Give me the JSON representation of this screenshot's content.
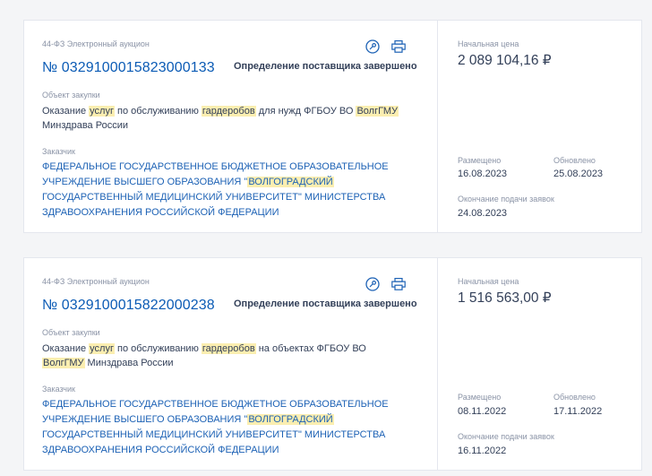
{
  "colors": {
    "link": "#1d62b5",
    "highlight": "#fbeeb0",
    "muted": "#8a93a6",
    "text": "#334059"
  },
  "icons": {
    "key": "key-icon",
    "print": "printer-icon"
  },
  "cards": [
    {
      "type": "44-ФЗ Электронный аукцион",
      "number": "№ 0329100015823000133",
      "status": "Определение поставщика завершено",
      "object_label": "Объект закупки",
      "object_parts": [
        {
          "t": "Оказание ",
          "h": false
        },
        {
          "t": "услуг",
          "h": true
        },
        {
          "t": " по обслуживанию ",
          "h": false
        },
        {
          "t": "гардеробов",
          "h": true
        },
        {
          "t": " для нужд ФГБОУ ВО ",
          "h": false
        },
        {
          "t": "ВолгГМУ",
          "h": true
        },
        {
          "t": " Минздрава России",
          "h": false
        }
      ],
      "customer_label": "Заказчик",
      "customer_parts": [
        {
          "t": "ФЕДЕРАЛЬНОЕ ГОСУДАРСТВЕННОЕ БЮДЖЕТНОЕ ОБРАЗОВАТЕЛЬНОЕ УЧРЕЖДЕНИЕ ВЫСШЕГО ОБРАЗОВАНИЯ \"",
          "h": false
        },
        {
          "t": "ВОЛГОГРАДСКИЙ",
          "h": true
        },
        {
          "t": " ГОСУДАРСТВЕННЫЙ МЕДИЦИНСКИЙ УНИВЕРСИТЕТ\" МИНИСТЕРСТВА ЗДРАВООХРАНЕНИЯ РОССИЙСКОЙ ФЕДЕРАЦИИ",
          "h": false
        }
      ],
      "price_label": "Начальная цена",
      "price": "2 089 104,16 ₽",
      "posted_label": "Размещено",
      "posted": "16.08.2023",
      "updated_label": "Обновлено",
      "updated": "25.08.2023",
      "deadline_label": "Окончание подачи заявок",
      "deadline": "24.08.2023"
    },
    {
      "type": "44-ФЗ Электронный аукцион",
      "number": "№ 0329100015822000238",
      "status": "Определение поставщика завершено",
      "object_label": "Объект закупки",
      "object_parts": [
        {
          "t": "Оказание ",
          "h": false
        },
        {
          "t": "услуг",
          "h": true
        },
        {
          "t": " по обслуживанию ",
          "h": false
        },
        {
          "t": "гардеробов",
          "h": true
        },
        {
          "t": " на объектах ФГБОУ ВО ",
          "h": false
        },
        {
          "t": "ВолгГМУ",
          "h": true
        },
        {
          "t": " Минздрава России",
          "h": false
        }
      ],
      "customer_label": "Заказчик",
      "customer_parts": [
        {
          "t": "ФЕДЕРАЛЬНОЕ ГОСУДАРСТВЕННОЕ БЮДЖЕТНОЕ ОБРАЗОВАТЕЛЬНОЕ УЧРЕЖДЕНИЕ ВЫСШЕГО ОБРАЗОВАНИЯ \"",
          "h": false
        },
        {
          "t": "ВОЛГОГРАДСКИЙ",
          "h": true
        },
        {
          "t": " ГОСУДАРСТВЕННЫЙ МЕДИЦИНСКИЙ УНИВЕРСИТЕТ\" МИНИСТЕРСТВА ЗДРАВООХРАНЕНИЯ РОССИЙСКОЙ ФЕДЕРАЦИИ",
          "h": false
        }
      ],
      "price_label": "Начальная цена",
      "price": "1 516 563,00 ₽",
      "posted_label": "Размещено",
      "posted": "08.11.2022",
      "updated_label": "Обновлено",
      "updated": "17.11.2022",
      "deadline_label": "Окончание подачи заявок",
      "deadline": "16.11.2022"
    }
  ]
}
